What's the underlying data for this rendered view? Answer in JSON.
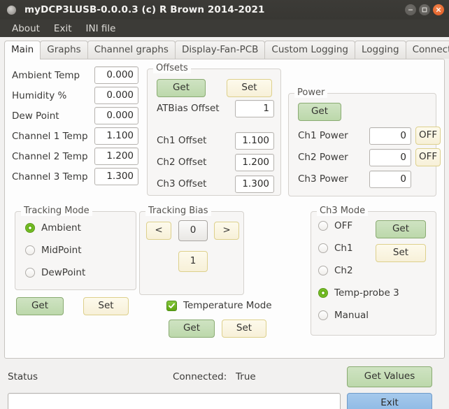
{
  "titlebar": {
    "title": "myDCP3LUSB-0.0.0.3 (c) R Brown 2014-2021",
    "minimize": "minimize-icon",
    "maximize": "maximize-icon",
    "close": "close-icon"
  },
  "menubar": {
    "items": [
      {
        "label": "About"
      },
      {
        "label": "Exit"
      },
      {
        "label": "INI file"
      }
    ]
  },
  "tabs": [
    {
      "label": "Main",
      "active": true
    },
    {
      "label": "Graphs",
      "active": false
    },
    {
      "label": "Channel graphs",
      "active": false
    },
    {
      "label": "Display-Fan-PCB",
      "active": false
    },
    {
      "label": "Custom Logging",
      "active": false
    },
    {
      "label": "Logging",
      "active": false
    },
    {
      "label": "Connection",
      "active": false
    }
  ],
  "readings": [
    {
      "label": "Ambient Temp",
      "value": "0.000"
    },
    {
      "label": "Humidity %",
      "value": "0.000"
    },
    {
      "label": "Dew Point",
      "value": "0.000"
    },
    {
      "label": "Channel 1 Temp",
      "value": "1.100"
    },
    {
      "label": "Channel 2 Temp",
      "value": "1.200"
    },
    {
      "label": "Channel 3 Temp",
      "value": "1.300"
    }
  ],
  "offsets": {
    "title": "Offsets",
    "get_label": "Get",
    "set_label": "Set",
    "atbias": {
      "label": "ATBias Offset",
      "value": "1"
    },
    "rows": [
      {
        "label": "Ch1 Offset",
        "value": "1.100"
      },
      {
        "label": "Ch2 Offset",
        "value": "1.200"
      },
      {
        "label": "Ch3 Offset",
        "value": "1.300"
      }
    ]
  },
  "power": {
    "title": "Power",
    "get_label": "Get",
    "rows": [
      {
        "label": "Ch1 Power",
        "value": "0",
        "toggle": "OFF"
      },
      {
        "label": "Ch2 Power",
        "value": "0",
        "toggle": "OFF"
      },
      {
        "label": "Ch3 Power",
        "value": "0",
        "toggle": null
      }
    ]
  },
  "tracking_mode": {
    "title": "Tracking Mode",
    "options": [
      {
        "label": "Ambient",
        "selected": true
      },
      {
        "label": "MidPoint",
        "selected": false
      },
      {
        "label": "DewPoint",
        "selected": false
      }
    ],
    "get_label": "Get",
    "set_label": "Set"
  },
  "tracking_bias": {
    "title": "Tracking Bias",
    "prev_label": "<",
    "next_label": ">",
    "value": "0",
    "secondary_value": "1"
  },
  "temperature_mode": {
    "label": "Temperature Mode",
    "checked": true,
    "get_label": "Get",
    "set_label": "Set"
  },
  "ch3_mode": {
    "title": "Ch3 Mode",
    "options": [
      {
        "label": "OFF",
        "selected": false
      },
      {
        "label": "Ch1",
        "selected": false
      },
      {
        "label": "Ch2",
        "selected": false
      },
      {
        "label": "Temp-probe 3",
        "selected": true
      },
      {
        "label": "Manual",
        "selected": false
      }
    ],
    "get_label": "Get",
    "set_label": "Set"
  },
  "statusbar": {
    "status_label": "Status",
    "connected_label": "Connected:",
    "connected_value": "True",
    "get_values_label": "Get Values",
    "exit_label": "Exit",
    "status_input_value": "",
    "status_input_placeholder": ""
  },
  "colors": {
    "accent_green": "#77c12a",
    "button_green": "#bcd8ab",
    "button_cream": "#f7f0d8",
    "button_blue": "#8cb8e4",
    "titlebar": "#3c3b37",
    "close_orange": "#e4622b"
  }
}
